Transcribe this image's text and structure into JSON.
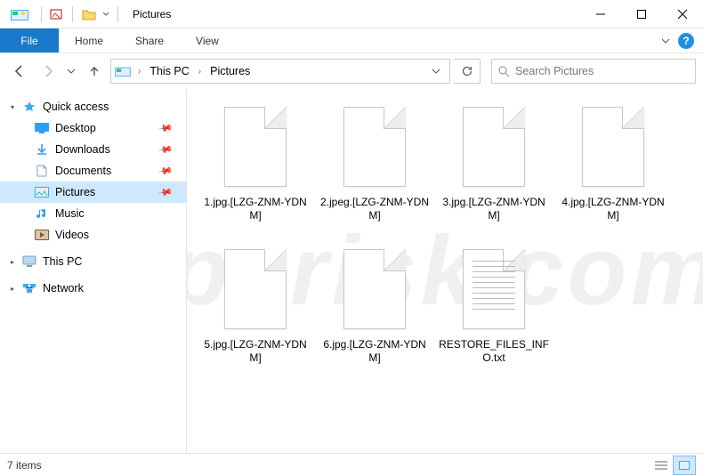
{
  "titlebar": {
    "title": "Pictures"
  },
  "ribbon": {
    "file": "File",
    "tabs": [
      "Home",
      "Share",
      "View"
    ]
  },
  "breadcrumb": {
    "root": "This PC",
    "current": "Pictures"
  },
  "search": {
    "placeholder": "Search Pictures"
  },
  "sidebar": {
    "quick_access": {
      "label": "Quick access",
      "items": [
        {
          "label": "Desktop",
          "icon": "desktop",
          "pinned": true
        },
        {
          "label": "Downloads",
          "icon": "downloads",
          "pinned": true
        },
        {
          "label": "Documents",
          "icon": "documents",
          "pinned": true
        },
        {
          "label": "Pictures",
          "icon": "pictures",
          "pinned": true,
          "selected": true
        },
        {
          "label": "Music",
          "icon": "music",
          "pinned": false
        },
        {
          "label": "Videos",
          "icon": "videos",
          "pinned": false
        }
      ]
    },
    "this_pc": {
      "label": "This PC"
    },
    "network": {
      "label": "Network"
    }
  },
  "files": [
    {
      "name": "1.jpg.[LZG-ZNM-YDNM]",
      "type": "blank"
    },
    {
      "name": "2.jpeg.[LZG-ZNM-YDNM]",
      "type": "blank"
    },
    {
      "name": "3.jpg.[LZG-ZNM-YDNM]",
      "type": "blank"
    },
    {
      "name": "4.jpg.[LZG-ZNM-YDNM]",
      "type": "blank"
    },
    {
      "name": "5.jpg.[LZG-ZNM-YDNM]",
      "type": "blank"
    },
    {
      "name": "6.jpg.[LZG-ZNM-YDNM]",
      "type": "blank"
    },
    {
      "name": "RESTORE_FILES_INFO.txt",
      "type": "txt"
    }
  ],
  "statusbar": {
    "count_label": "7 items"
  },
  "watermark": "pcrisk.com"
}
